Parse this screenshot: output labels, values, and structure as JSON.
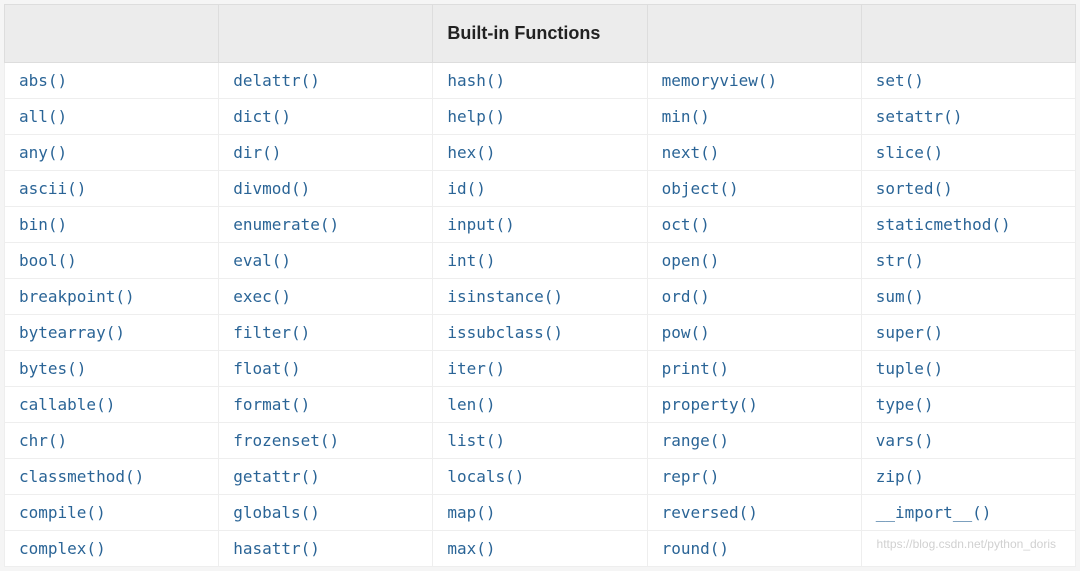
{
  "table": {
    "headers": [
      "",
      "",
      "Built-in Functions",
      "",
      ""
    ],
    "rows": [
      [
        "abs()",
        "delattr()",
        "hash()",
        "memoryview()",
        "set()"
      ],
      [
        "all()",
        "dict()",
        "help()",
        "min()",
        "setattr()"
      ],
      [
        "any()",
        "dir()",
        "hex()",
        "next()",
        "slice()"
      ],
      [
        "ascii()",
        "divmod()",
        "id()",
        "object()",
        "sorted()"
      ],
      [
        "bin()",
        "enumerate()",
        "input()",
        "oct()",
        "staticmethod()"
      ],
      [
        "bool()",
        "eval()",
        "int()",
        "open()",
        "str()"
      ],
      [
        "breakpoint()",
        "exec()",
        "isinstance()",
        "ord()",
        "sum()"
      ],
      [
        "bytearray()",
        "filter()",
        "issubclass()",
        "pow()",
        "super()"
      ],
      [
        "bytes()",
        "float()",
        "iter()",
        "print()",
        "tuple()"
      ],
      [
        "callable()",
        "format()",
        "len()",
        "property()",
        "type()"
      ],
      [
        "chr()",
        "frozenset()",
        "list()",
        "range()",
        "vars()"
      ],
      [
        "classmethod()",
        "getattr()",
        "locals()",
        "repr()",
        "zip()"
      ],
      [
        "compile()",
        "globals()",
        "map()",
        "reversed()",
        "__import__()"
      ],
      [
        "complex()",
        "hasattr()",
        "max()",
        "round()",
        ""
      ]
    ]
  },
  "watermark": "https://blog.csdn.net/python_doris"
}
